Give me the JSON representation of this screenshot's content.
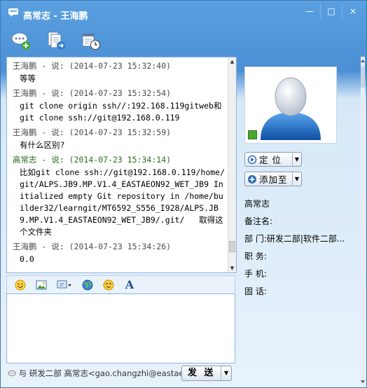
{
  "window": {
    "title": "高常志 - 王海鹏",
    "buttons": [
      "—",
      "□",
      "×"
    ]
  },
  "toolbar": {
    "icons": [
      "chat-plus-icon",
      "document-plus-icon",
      "calendar-clock-icon"
    ]
  },
  "messages": [
    {
      "sender": "王海鹏",
      "said": "说",
      "time": "(2014-07-23 15:32:40)",
      "text": "等等"
    },
    {
      "sender": "王海鹏",
      "said": "说",
      "time": "(2014-07-23 15:32:54)",
      "text": "git clone origin ssh//:192.168.119gitweb和  git clone ssh://git@192.168.0.119"
    },
    {
      "sender": "王海鹏",
      "said": "说",
      "time": "(2014-07-23 15:32:59)",
      "text": "有什么区别?"
    },
    {
      "sender": "高常志",
      "said": "说",
      "time": "(2014-07-23 15:34:14)",
      "text": "比如git clone ssh://git@192.168.0.119/home/git/ALPS.JB9.MP.V1.4_EASTAEON92_WET_JB9 Initialized empty Git repository in /home/builder32/learngit/MT6592_S556_I928/ALPS.JB9.MP.V1.4_EASTAEON92_WET_JB9/.git/   取得这个文件夹"
    },
    {
      "sender": "王海鹏",
      "said": "说",
      "time": "(2014-07-23 15:34:26)",
      "text": "0.0"
    }
  ],
  "format_bar": {
    "icons": [
      "emoticon-icon",
      "picture-icon",
      "screenshot-icon",
      "globe-icon",
      "face-icon",
      "font-icon"
    ],
    "font_glyph": "A"
  },
  "footer": {
    "text": "与 研发二部 高常志<gao.changzhi@eastae",
    "send_label": "发 送"
  },
  "profile": {
    "locate_label": "定 位",
    "add_label": "添加至",
    "name": "高常志",
    "fields": [
      {
        "label": "备注名:",
        "value": ""
      },
      {
        "label": "部   门:",
        "value": "研发二部|软件二部..."
      },
      {
        "label": "职   务:",
        "value": ""
      },
      {
        "label": "手   机:",
        "value": ""
      },
      {
        "label": "固   话:",
        "value": ""
      }
    ]
  },
  "colors": {
    "title_bar": "#4b8fd5",
    "me_header": "#2b6b1e",
    "online": "#4aa532"
  }
}
